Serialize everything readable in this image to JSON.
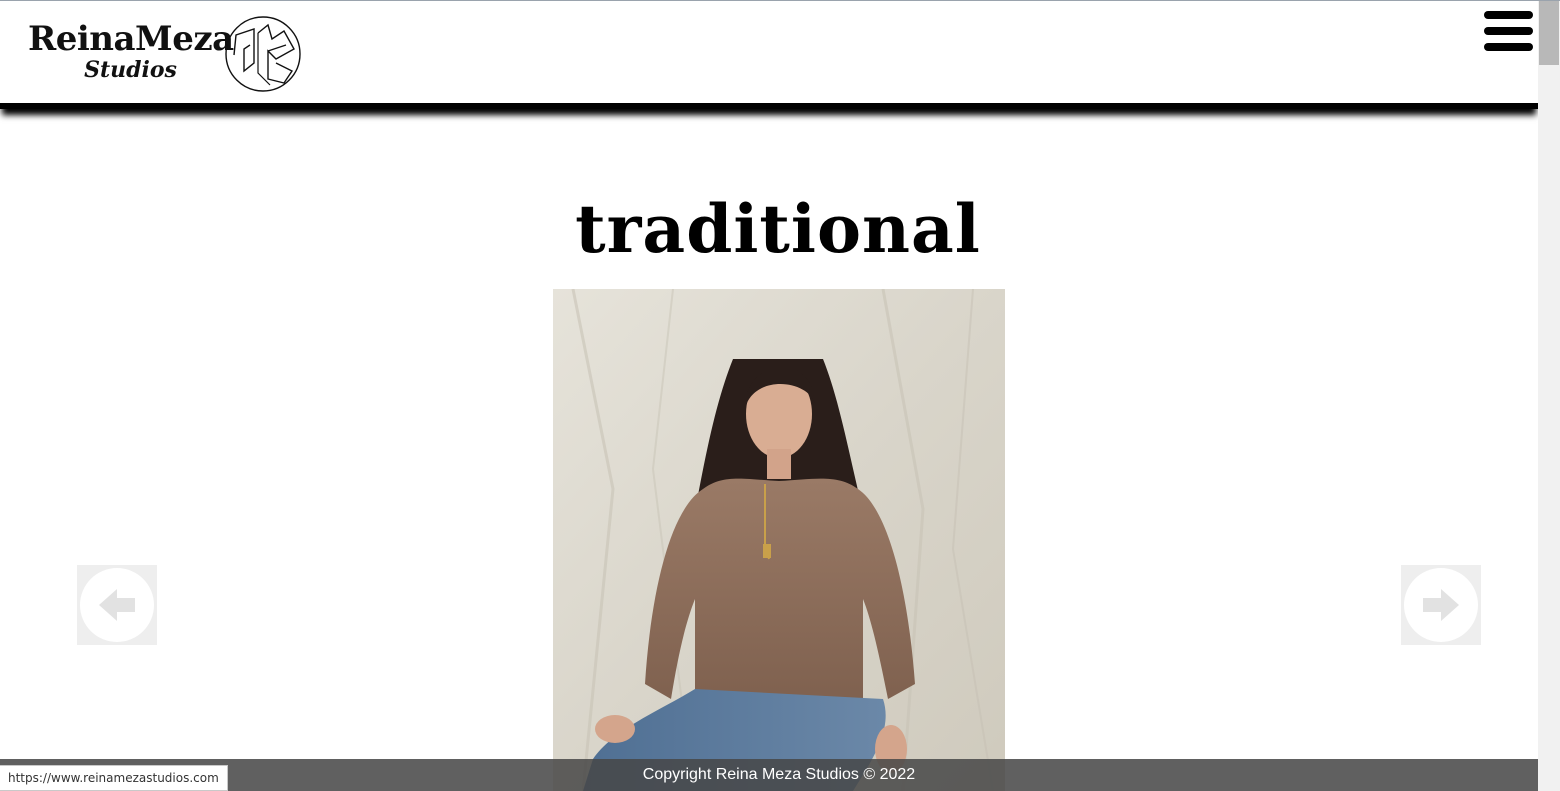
{
  "header": {
    "logo_title": "ReinaMeza",
    "logo_subtitle": "Studios",
    "menu_icon": "hamburger-menu-icon"
  },
  "gallery": {
    "title": "traditional",
    "prev_icon": "arrow-left-icon",
    "next_icon": "arrow-right-icon"
  },
  "footer": {
    "copyright": "Copyright Reina Meza Studios © 2022"
  },
  "status_bar": {
    "url": "https://www.reinamezastudios.com"
  },
  "colors": {
    "header_bg": "#ffffff",
    "text": "#000000",
    "footer_bg": "#606060",
    "arrow_bg": "#eeeeee",
    "arrow_glyph": "#e0e0e0"
  }
}
